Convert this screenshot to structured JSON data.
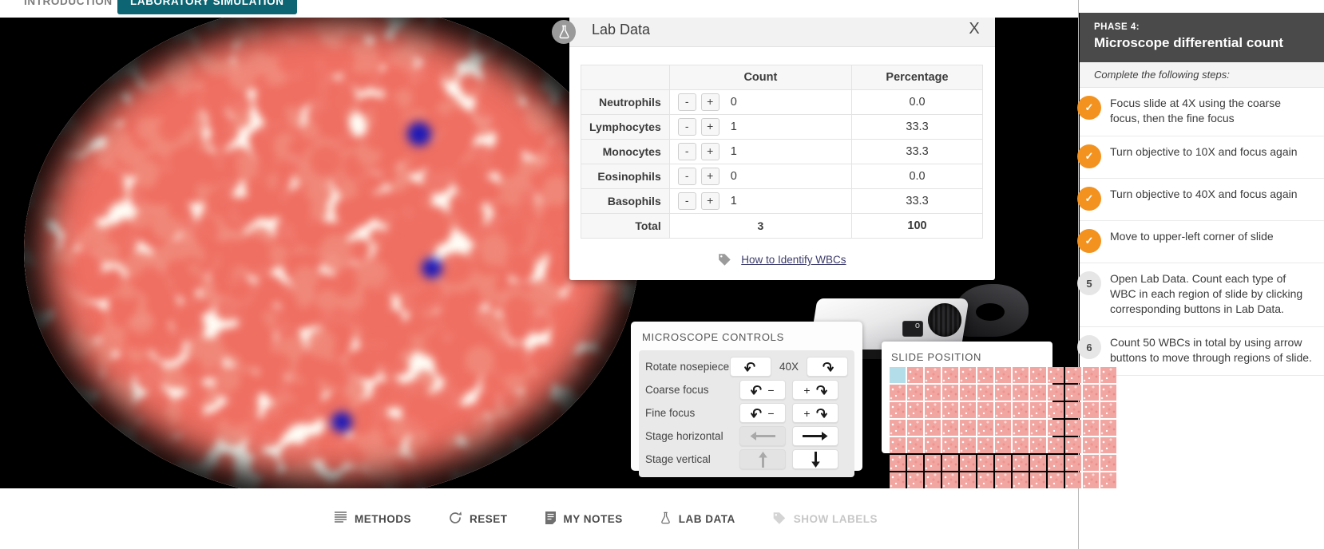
{
  "tabs": [
    {
      "label": "INTRODUCTION",
      "active": false
    },
    {
      "label": "LABORATORY SIMULATION",
      "active": true
    }
  ],
  "dialog": {
    "title": "Lab Data",
    "close_label": "X",
    "flask_icon": "flask-icon",
    "columns": {
      "blank": "",
      "count": "Count",
      "percentage": "Percentage"
    },
    "rows": [
      {
        "label": "Neutrophils",
        "minus": "-",
        "plus": "+",
        "count": "0",
        "percentage": "0.0"
      },
      {
        "label": "Lymphocytes",
        "minus": "-",
        "plus": "+",
        "count": "1",
        "percentage": "33.3"
      },
      {
        "label": "Monocytes",
        "minus": "-",
        "plus": "+",
        "count": "1",
        "percentage": "33.3"
      },
      {
        "label": "Eosinophils",
        "minus": "-",
        "plus": "+",
        "count": "0",
        "percentage": "0.0"
      },
      {
        "label": "Basophils",
        "minus": "-",
        "plus": "+",
        "count": "1",
        "percentage": "33.3"
      }
    ],
    "total": {
      "label": "Total",
      "count": "3",
      "percentage": "100"
    },
    "link": {
      "icon": "tag-icon",
      "label": "How to Identify WBCs"
    }
  },
  "microscope_controls": {
    "title": "MICROSCOPE CONTROLS",
    "magnification": "40X",
    "rows": [
      {
        "label": "Rotate nosepiece",
        "left_icon": "rotate-left-icon",
        "right_icon": "rotate-right-icon",
        "left_sign": "",
        "right_sign": "",
        "left_disabled": false,
        "right_disabled": false
      },
      {
        "label": "Coarse focus",
        "left_icon": "rotate-left-icon",
        "right_icon": "rotate-right-icon",
        "left_sign": "−",
        "right_sign": "+",
        "left_disabled": false,
        "right_disabled": false
      },
      {
        "label": "Fine focus",
        "left_icon": "rotate-left-icon",
        "right_icon": "rotate-right-icon",
        "left_sign": "−",
        "right_sign": "+",
        "left_disabled": false,
        "right_disabled": false
      },
      {
        "label": "Stage horizontal",
        "left_icon": "arrow-left-icon",
        "right_icon": "arrow-right-icon",
        "left_sign": "",
        "right_sign": "",
        "left_disabled": true,
        "right_disabled": false
      },
      {
        "label": "Stage vertical",
        "left_icon": "arrow-up-icon",
        "right_icon": "arrow-down-icon",
        "left_sign": "",
        "right_sign": "",
        "left_disabled": true,
        "right_disabled": false
      }
    ]
  },
  "slide_position": {
    "title": "SLIDE POSITION",
    "columns": 13,
    "rows": 7,
    "active_cell": {
      "row": 0,
      "col": 0
    },
    "active_color": "#b3dde8",
    "cell_color": "#f2a6a2"
  },
  "toolbar": [
    {
      "label": "METHODS",
      "icon": "lines-icon",
      "disabled": false
    },
    {
      "label": "RESET",
      "icon": "refresh-icon",
      "disabled": false
    },
    {
      "label": "MY NOTES",
      "icon": "note-icon",
      "disabled": false
    },
    {
      "label": "LAB DATA",
      "icon": "flask-icon",
      "disabled": false
    },
    {
      "label": "SHOW LABELS",
      "icon": "tag-icon",
      "disabled": true
    }
  ],
  "sidebar": {
    "phase_kicker": "PHASE 4:",
    "phase_title": "Microscope differential count",
    "steps_intro": "Complete the following steps:",
    "accent_done": "#f3921e",
    "steps": [
      {
        "badge": "✓",
        "done": true,
        "text": "Focus slide at 4X using the coarse focus, then the fine focus"
      },
      {
        "badge": "✓",
        "done": true,
        "text": "Turn objective to 10X and focus again"
      },
      {
        "badge": "✓",
        "done": true,
        "text": "Turn objective to 40X and focus again"
      },
      {
        "badge": "✓",
        "done": true,
        "text": "Move to upper-left corner of slide"
      },
      {
        "badge": "5",
        "done": false,
        "text": "Open Lab Data. Count each type of WBC in each region of slide by clicking corresponding buttons in Lab Data."
      },
      {
        "badge": "6",
        "done": false,
        "text": "Count 50 WBCs in total by using arrow buttons to move through regions of slide."
      }
    ]
  }
}
